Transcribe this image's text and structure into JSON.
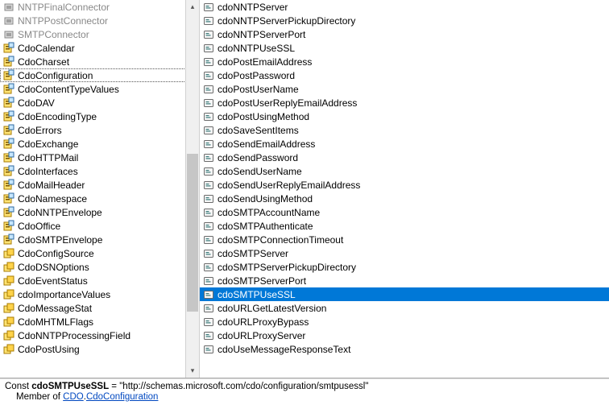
{
  "left_items": [
    {
      "label": "NNTPFinalConnector",
      "icon": "module",
      "disabled": true
    },
    {
      "label": "NNTPPostConnector",
      "icon": "module",
      "disabled": true
    },
    {
      "label": "SMTPConnector",
      "icon": "module",
      "disabled": true
    },
    {
      "label": "CdoCalendar",
      "icon": "enum"
    },
    {
      "label": "CdoCharset",
      "icon": "enum"
    },
    {
      "label": "CdoConfiguration",
      "icon": "enum",
      "selected": true
    },
    {
      "label": "CdoContentTypeValues",
      "icon": "enum"
    },
    {
      "label": "CdoDAV",
      "icon": "enum"
    },
    {
      "label": "CdoEncodingType",
      "icon": "enum"
    },
    {
      "label": "CdoErrors",
      "icon": "enum"
    },
    {
      "label": "CdoExchange",
      "icon": "enum"
    },
    {
      "label": "CdoHTTPMail",
      "icon": "enum"
    },
    {
      "label": "CdoInterfaces",
      "icon": "enum"
    },
    {
      "label": "CdoMailHeader",
      "icon": "enum"
    },
    {
      "label": "CdoNamespace",
      "icon": "enum"
    },
    {
      "label": "CdoNNTPEnvelope",
      "icon": "enum"
    },
    {
      "label": "CdoOffice",
      "icon": "enum"
    },
    {
      "label": "CdoSMTPEnvelope",
      "icon": "enum"
    },
    {
      "label": "CdoConfigSource",
      "icon": "enum2"
    },
    {
      "label": "CdoDSNOptions",
      "icon": "enum2"
    },
    {
      "label": "CdoEventStatus",
      "icon": "enum2"
    },
    {
      "label": "cdoImportanceValues",
      "icon": "enum2"
    },
    {
      "label": "CdoMessageStat",
      "icon": "enum2"
    },
    {
      "label": "CdoMHTMLFlags",
      "icon": "enum2"
    },
    {
      "label": "CdoNNTPProcessingField",
      "icon": "enum2"
    },
    {
      "label": "CdoPostUsing",
      "icon": "enum2"
    }
  ],
  "right_items": [
    {
      "label": "cdoNNTPServer"
    },
    {
      "label": "cdoNNTPServerPickupDirectory"
    },
    {
      "label": "cdoNNTPServerPort"
    },
    {
      "label": "cdoNNTPUseSSL"
    },
    {
      "label": "cdoPostEmailAddress"
    },
    {
      "label": "cdoPostPassword"
    },
    {
      "label": "cdoPostUserName"
    },
    {
      "label": "cdoPostUserReplyEmailAddress"
    },
    {
      "label": "cdoPostUsingMethod"
    },
    {
      "label": "cdoSaveSentItems"
    },
    {
      "label": "cdoSendEmailAddress"
    },
    {
      "label": "cdoSendPassword"
    },
    {
      "label": "cdoSendUserName"
    },
    {
      "label": "cdoSendUserReplyEmailAddress"
    },
    {
      "label": "cdoSendUsingMethod"
    },
    {
      "label": "cdoSMTPAccountName"
    },
    {
      "label": "cdoSMTPAuthenticate"
    },
    {
      "label": "cdoSMTPConnectionTimeout"
    },
    {
      "label": "cdoSMTPServer"
    },
    {
      "label": "cdoSMTPServerPickupDirectory"
    },
    {
      "label": "cdoSMTPServerPort"
    },
    {
      "label": "cdoSMTPUseSSL",
      "selected": true
    },
    {
      "label": "cdoURLGetLatestVersion"
    },
    {
      "label": "cdoURLProxyBypass"
    },
    {
      "label": "cdoURLProxyServer"
    },
    {
      "label": "cdoUseMessageResponseText"
    }
  ],
  "status": {
    "prefix": "Const ",
    "name": "cdoSMTPUseSSL",
    "assign": " = \"http://schemas.microsoft.com/cdo/configuration/smtpusessl\"",
    "member_prefix": "Member of ",
    "lib": "CDO",
    "sep": ".",
    "cls": "CdoConfiguration"
  }
}
